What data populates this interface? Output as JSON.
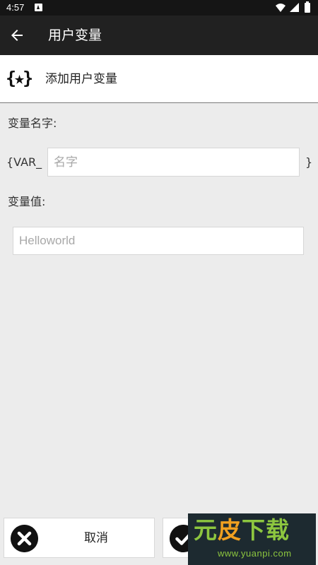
{
  "status_bar": {
    "time": "4:57"
  },
  "app_bar": {
    "title": "用户变量"
  },
  "dialog": {
    "icon_text": "{★}",
    "title": "添加用户变量"
  },
  "form": {
    "name_label": "变量名字:",
    "name_prefix": "{VAR_",
    "name_placeholder": "名字",
    "name_suffix": "}",
    "value_label": "变量值:",
    "value_placeholder": "Helloworld"
  },
  "buttons": {
    "cancel_label": "取消",
    "ok_label": "OK"
  },
  "watermark": {
    "brand_green": "元",
    "brand_orange": "皮",
    "brand_rest": "下载",
    "url": "www.yuanpi.com"
  },
  "colors": {
    "status_bar": "#151515",
    "app_bar": "#212121",
    "background": "#ececec",
    "watermark_green": "#8dc63f",
    "watermark_orange": "#f0a020"
  }
}
